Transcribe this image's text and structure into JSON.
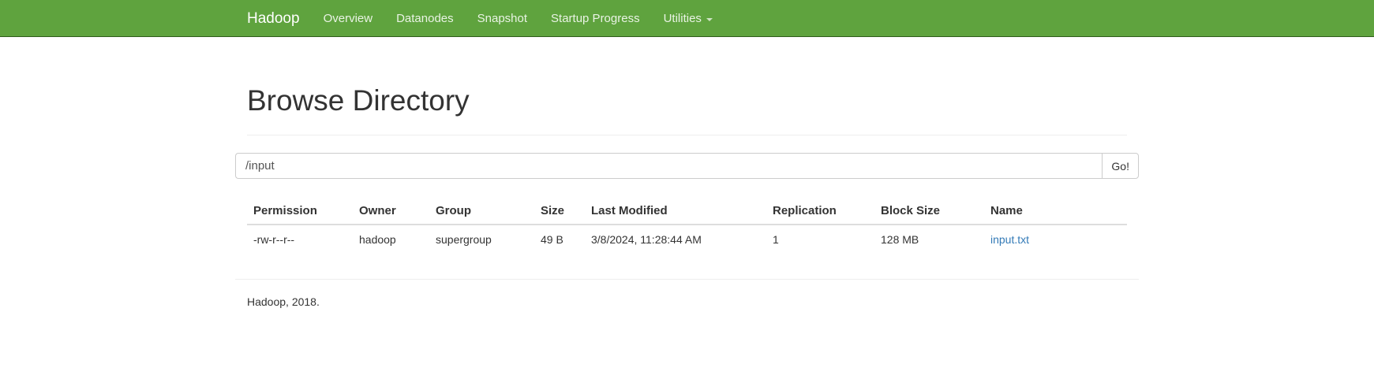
{
  "navbar": {
    "brand": "Hadoop",
    "items": [
      "Overview",
      "Datanodes",
      "Snapshot",
      "Startup Progress",
      "Utilities"
    ]
  },
  "page": {
    "title": "Browse Directory"
  },
  "search": {
    "value": "/input",
    "button_label": "Go!"
  },
  "table": {
    "headers": [
      "Permission",
      "Owner",
      "Group",
      "Size",
      "Last Modified",
      "Replication",
      "Block Size",
      "Name"
    ],
    "rows": [
      [
        "-rw-r--r--",
        "hadoop",
        "supergroup",
        "49 B",
        "3/8/2024, 11:28:44 AM",
        "1",
        "128 MB",
        "input.txt"
      ]
    ]
  },
  "footer": {
    "text": "Hadoop, 2018."
  },
  "colors": {
    "navbar_bg": "#5fa33e",
    "link": "#337ab7"
  }
}
